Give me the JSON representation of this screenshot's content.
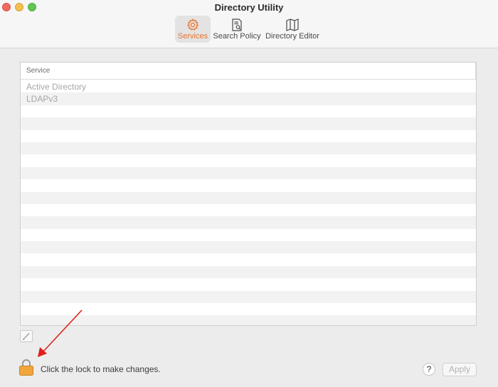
{
  "window": {
    "title": "Directory Utility"
  },
  "toolbar": {
    "items": [
      {
        "label": "Services",
        "icon": "gear-icon",
        "active": true
      },
      {
        "label": "Search Policy",
        "icon": "document-search-icon",
        "active": false
      },
      {
        "label": "Directory Editor",
        "icon": "map-icon",
        "active": false
      }
    ]
  },
  "table": {
    "column_header": "Service",
    "rows": [
      "Active Directory",
      "LDAPv3",
      "",
      "",
      "",
      "",
      "",
      "",
      "",
      "",
      "",
      "",
      "",
      "",
      "",
      "",
      "",
      "",
      "",
      ""
    ]
  },
  "footer": {
    "lock_text": "Click the lock to make changes.",
    "help_label": "?",
    "apply_label": "Apply"
  },
  "colors": {
    "accent": "#e8742c",
    "lock": "#f0a63a",
    "annotation_arrow": "#e0201a"
  }
}
